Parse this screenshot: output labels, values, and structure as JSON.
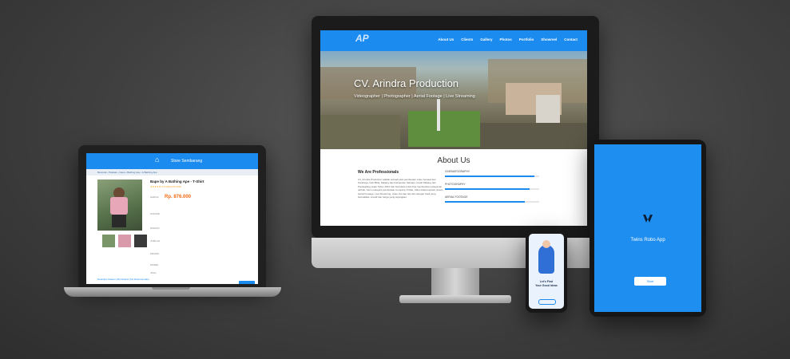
{
  "imac_site": {
    "nav": [
      "About Us",
      "Clients",
      "Gallery",
      "Photos",
      "Portfolio",
      "Showreel",
      "Contact"
    ],
    "hero_title": "CV. Arindra Production",
    "hero_subtitle": "Videographer | Photographer | Aerial Footage | Live Streaming",
    "about_title": "About Us",
    "about_heading": "We Are Professionals",
    "about_text": "CV. Arindra Production adalah sebuah jasa pembuatan video berasal dari Surabaya, Kab Blitar, Malang dan Kabupaten Sidoarjo, Kediri Malang dan Pandeglang sejak Tahun 2010 dan bertekad untuk bisa memberikan pelayanan terbaik. Kami melayani pembuatan Company Profile, Video Dokumentasi, Event, Aerial Footage, Live Streaming, video clip dan lain-lain dengan hasil yang berkualitas, kreatif dan harga yang terjangkau.",
    "skills": [
      {
        "label": "CINEMATOGRAPHY",
        "level": 0.95
      },
      {
        "label": "PHOTOGRAPHY",
        "level": 0.9
      },
      {
        "label": "AERIAL FOOTAGE",
        "level": 0.85
      }
    ]
  },
  "laptop_site": {
    "shop_name": "Store Sembarang",
    "breadcrumb": "Beranda • Pakaian • Kaos • Bathing Ape • A Bathing Ape",
    "product_title": "Bape by A Bathing Ape - T-Shirt",
    "rating_text": "★★★★★ 4.9 Dilihat 50.000x",
    "price_label": "HARGA",
    "price": "Rp. 876.000",
    "rows": [
      "ONGKIR",
      "DISKON",
      "JUMLAH",
      "PROMO",
      "MODEL",
      "JASA"
    ],
    "tabs": "Deskripsi   Ulasan (39)   Diskusi (12)   Rekomendasi",
    "buy_label": "Beli"
  },
  "phone_app": {
    "title_line1": "Let's Find",
    "title_line2": "Your Good Ideas"
  },
  "tablet_app": {
    "app_name": "Twins Robo App",
    "button_label": "Start"
  },
  "colors": {
    "accent": "#1c8bef",
    "background": "#444444",
    "price": "#f26a12"
  }
}
